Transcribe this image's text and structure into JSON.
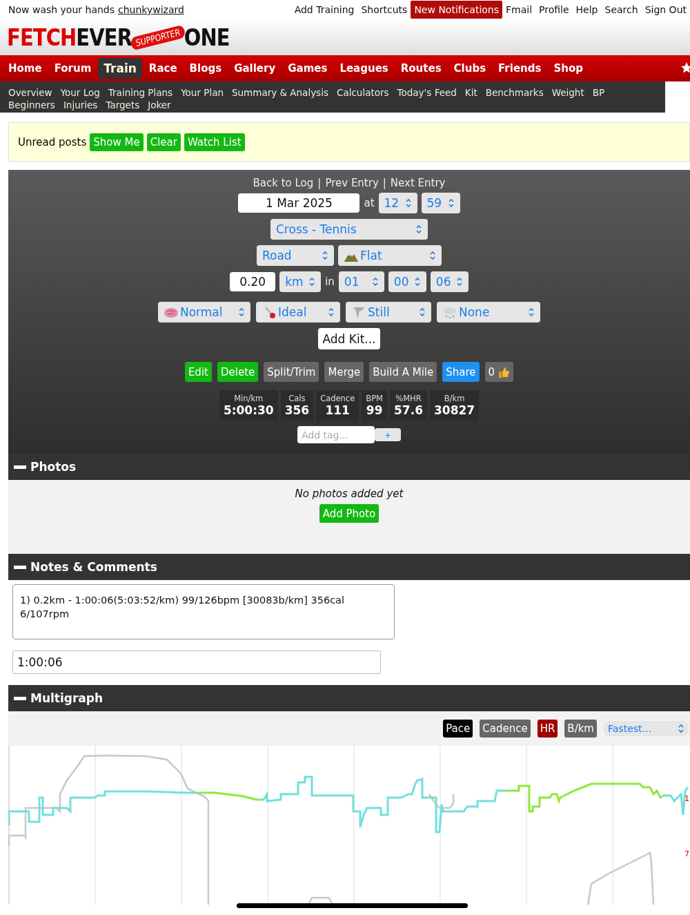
{
  "top_bar": {
    "greeting": "Now wash your hands",
    "username": "chunkywizard",
    "links": [
      {
        "label": "Add Training",
        "highlighted": false
      },
      {
        "label": "Shortcuts",
        "highlighted": false
      },
      {
        "label": "New Notifications",
        "highlighted": true
      },
      {
        "label": "Fmail",
        "highlighted": false
      },
      {
        "label": "Profile",
        "highlighted": false
      },
      {
        "label": "Help",
        "highlighted": false
      },
      {
        "label": "Search",
        "highlighted": false
      },
      {
        "label": "Sign Out",
        "highlighted": false
      }
    ]
  },
  "logo": {
    "first": "FETCH",
    "second": "EVER",
    "badge": "SUPPORTER",
    "third": "ONE"
  },
  "main_nav": [
    {
      "label": "Home",
      "selected": false
    },
    {
      "label": "Forum",
      "selected": false
    },
    {
      "label": "Train",
      "selected": true
    },
    {
      "label": "Race",
      "selected": false
    },
    {
      "label": "Blogs",
      "selected": false
    },
    {
      "label": "Gallery",
      "selected": false
    },
    {
      "label": "Games",
      "selected": false
    },
    {
      "label": "Leagues",
      "selected": false
    },
    {
      "label": "Routes",
      "selected": false
    },
    {
      "label": "Clubs",
      "selected": false
    },
    {
      "label": "Friends",
      "selected": false
    },
    {
      "label": "Shop",
      "selected": false
    }
  ],
  "sub_nav": [
    "Overview",
    "Your Log",
    "Training Plans",
    "Your Plan",
    "Summary & Analysis",
    "Calculators",
    "Today's Feed",
    "Kit",
    "Benchmarks",
    "Weight",
    "BP",
    "Beginners",
    "Injuries",
    "Targets",
    "Joker"
  ],
  "unread": {
    "label": "Unread posts",
    "buttons": [
      "Show Me",
      "Clear",
      "Watch List"
    ]
  },
  "entry": {
    "links": [
      "Back to Log",
      "Prev Entry",
      "Next Entry"
    ],
    "separator": "|",
    "date": "1 Mar 2025",
    "at": "at",
    "hour": "12",
    "minute": "59",
    "activity": "Cross - Tennis",
    "surface": "Road",
    "terrain": "Flat",
    "distance": "0.20",
    "unit": "km",
    "in": "in",
    "hours": "01",
    "minutes": "00",
    "seconds": "06",
    "conditions": [
      "Normal",
      "Ideal",
      "Still",
      "None"
    ],
    "add_kit": "Add Kit...",
    "actions": [
      {
        "label": "Edit",
        "color": "#14b814"
      },
      {
        "label": "Delete",
        "color": "#14b814"
      },
      {
        "label": "Split/Trim",
        "color": "#666666"
      },
      {
        "label": "Merge",
        "color": "#666666"
      },
      {
        "label": "Build A Mile",
        "color": "#666666"
      },
      {
        "label": "Share",
        "color": "#1e90ee"
      },
      {
        "label": "0",
        "color": "#666666"
      }
    ],
    "stats": [
      {
        "label": "Min/km",
        "value": "5:00:30"
      },
      {
        "label": "Cals",
        "value": "356"
      },
      {
        "label": "Cadence",
        "value": "111"
      },
      {
        "label": "BPM",
        "value": "99"
      },
      {
        "label": "%MHR",
        "value": "57.6"
      },
      {
        "label": "B/km",
        "value": "30827"
      }
    ],
    "tag": {
      "placeholder": "Add tag..."
    },
    "tag_add": "+"
  },
  "photos": {
    "title": "Photos",
    "empty": "No photos added yet",
    "button": "Add Photo"
  },
  "notes": {
    "title": "Notes & Comments",
    "text": "1) 0.2km - 1:00:06(5:03:52/km) 99/126bpm [30083b/km] 356cal 6/107rpm",
    "time": "1:00:06"
  },
  "multigraph": {
    "title": "Multigraph",
    "buttons": [
      {
        "label": "Pace",
        "color": "#000000"
      },
      {
        "label": "Cadence",
        "color": "#666666"
      },
      {
        "label": "HR",
        "color": "#a00000"
      },
      {
        "label": "B/km",
        "color": "#666666"
      }
    ],
    "select": "Fastest...",
    "axis_labels": [
      "1",
      "7"
    ]
  }
}
